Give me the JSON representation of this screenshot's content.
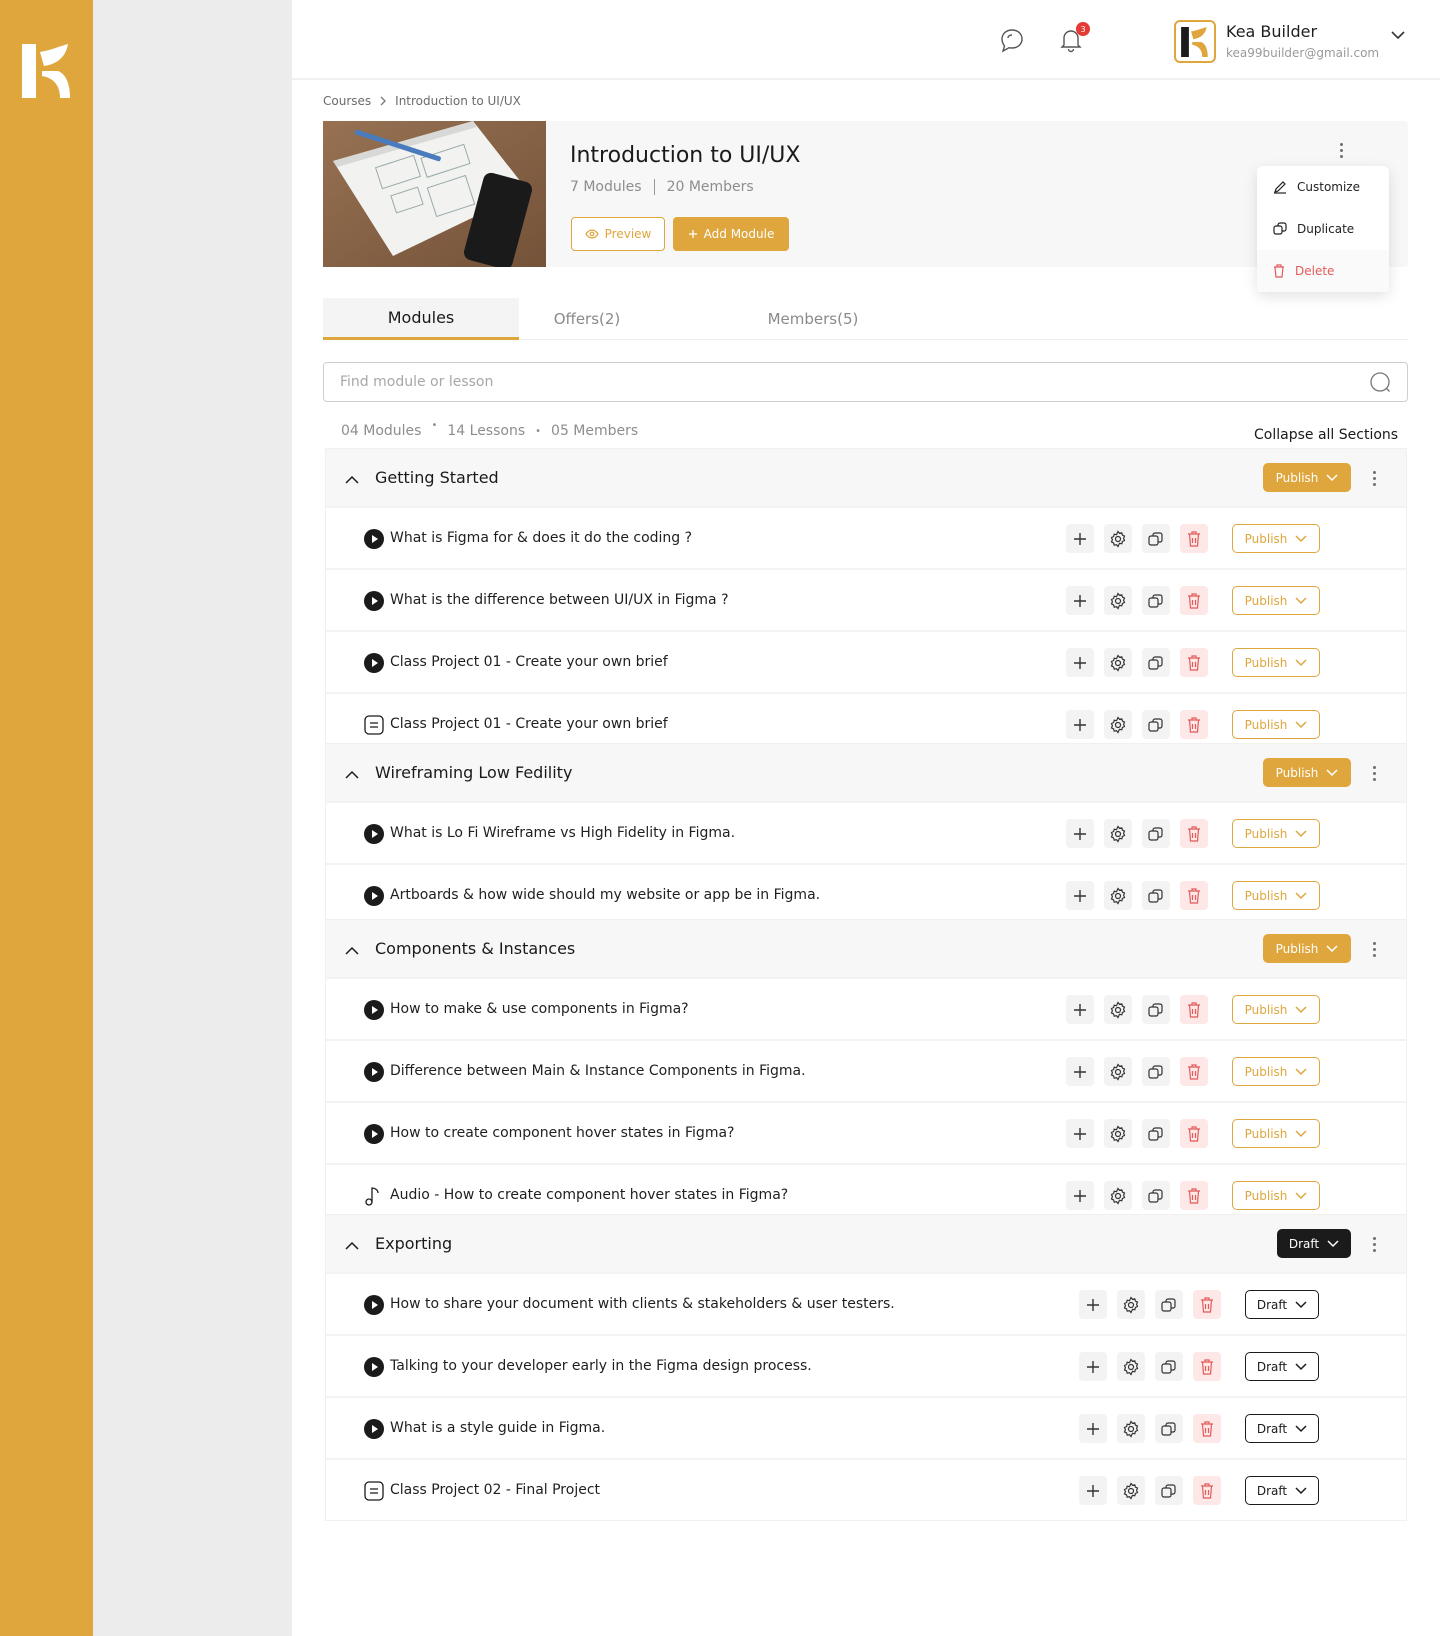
{
  "brand": {
    "accent": "#DFA63D",
    "danger": "#E35A5A",
    "dark": "#1b1b1b"
  },
  "header": {
    "notifications_count": "3",
    "user": {
      "name": "Kea Builder",
      "email": "kea99builder@gmail.com"
    }
  },
  "breadcrumb": {
    "root": "Courses",
    "current": "Introduction to UI/UX"
  },
  "course": {
    "title": "Introduction to UI/UX",
    "modules": "7 Modules",
    "members": "20 Members",
    "preview_label": "Preview",
    "add_module_label": "Add Module"
  },
  "menu": {
    "customize": "Customize",
    "duplicate": "Duplicate",
    "delete": "Delete"
  },
  "tabs": [
    "Modules",
    "Offers(2)",
    "Members(5)"
  ],
  "search": {
    "placeholder": "Find module or lesson"
  },
  "stats": {
    "modules": "04 Modules",
    "lessons": "14 Lessons",
    "members": "05 Members"
  },
  "collapse_label": "Collapse all Sections",
  "modules": [
    {
      "title": "Getting Started",
      "status": "Publish",
      "lessons": [
        {
          "icon": "play",
          "title": "What is Figma for & does it do the coding ?",
          "status": "Publish"
        },
        {
          "icon": "play",
          "title": "What is the difference between UI/UX in Figma ?",
          "status": "Publish"
        },
        {
          "icon": "play",
          "title": "Class Project 01 - Create your own brief",
          "status": "Publish"
        },
        {
          "icon": "doc",
          "title": "Class Project 01 - Create your own brief",
          "status": "Publish"
        }
      ]
    },
    {
      "title": "Wireframing Low Fedility",
      "status": "Publish",
      "lessons": [
        {
          "icon": "play",
          "title": "What is Lo Fi Wireframe vs High Fidelity in Figma.",
          "status": "Publish"
        },
        {
          "icon": "play",
          "title": "Artboards & how wide should my website or app be in Figma.",
          "status": "Publish"
        }
      ]
    },
    {
      "title": "Components & Instances",
      "status": "Publish",
      "lessons": [
        {
          "icon": "play",
          "title": "How to make & use components in Figma?",
          "status": "Publish"
        },
        {
          "icon": "play",
          "title": "Difference between Main & Instance Components in Figma.",
          "status": "Publish"
        },
        {
          "icon": "play",
          "title": "How to create component hover states in Figma?",
          "status": "Publish"
        },
        {
          "icon": "audio",
          "title": "Audio - How to create component hover states in Figma?",
          "status": "Publish"
        }
      ]
    },
    {
      "title": "Exporting",
      "status": "Draft",
      "lessons": [
        {
          "icon": "play",
          "title": "How to share your document with clients & stakeholders & user testers.",
          "status": "Draft"
        },
        {
          "icon": "play",
          "title": "Talking to your developer early in the Figma design process.",
          "status": "Draft"
        },
        {
          "icon": "play",
          "title": "What is a style guide in Figma.",
          "status": "Draft"
        },
        {
          "icon": "doc",
          "title": "Class Project 02 - Final Project",
          "status": "Draft"
        }
      ]
    }
  ]
}
